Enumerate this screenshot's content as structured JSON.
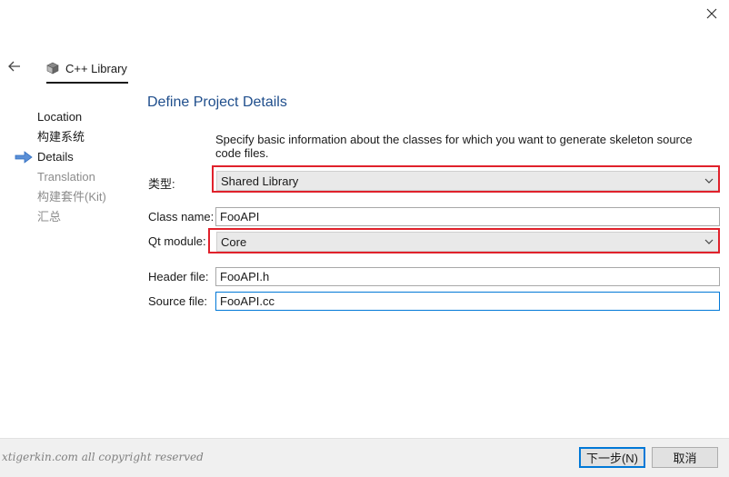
{
  "window": {
    "close_icon": "close-icon",
    "back_icon": "back-arrow-icon"
  },
  "wizard": {
    "tab_label": "C++ Library",
    "tab_icon": "cube-icon"
  },
  "steps": [
    {
      "label": "Location",
      "state": "done"
    },
    {
      "label": "构建系统",
      "state": "done"
    },
    {
      "label": "Details",
      "state": "current"
    },
    {
      "label": "Translation",
      "state": "pending"
    },
    {
      "label": "构建套件(Kit)",
      "state": "pending"
    },
    {
      "label": "汇总",
      "state": "pending"
    }
  ],
  "page": {
    "title": "Define Project Details",
    "description": "Specify basic information about the classes for which you want to generate skeleton source code files."
  },
  "form": {
    "type_label": "类型:",
    "type_value": "Shared Library",
    "class_label": "Class name:",
    "class_value": "FooAPI",
    "module_label": "Qt module:",
    "module_value": "Core",
    "header_label": "Header file:",
    "header_value": "FooAPI.h",
    "source_label": "Source file:",
    "source_value": "FooAPI.cc"
  },
  "footer": {
    "watermark": "xtigerkin.com all copyright reserved",
    "next_label": "下一步(N)",
    "cancel_label": "取消"
  },
  "colors": {
    "accent": "#0078d7",
    "highlight": "#e0212b",
    "title": "#1f4e8c"
  }
}
